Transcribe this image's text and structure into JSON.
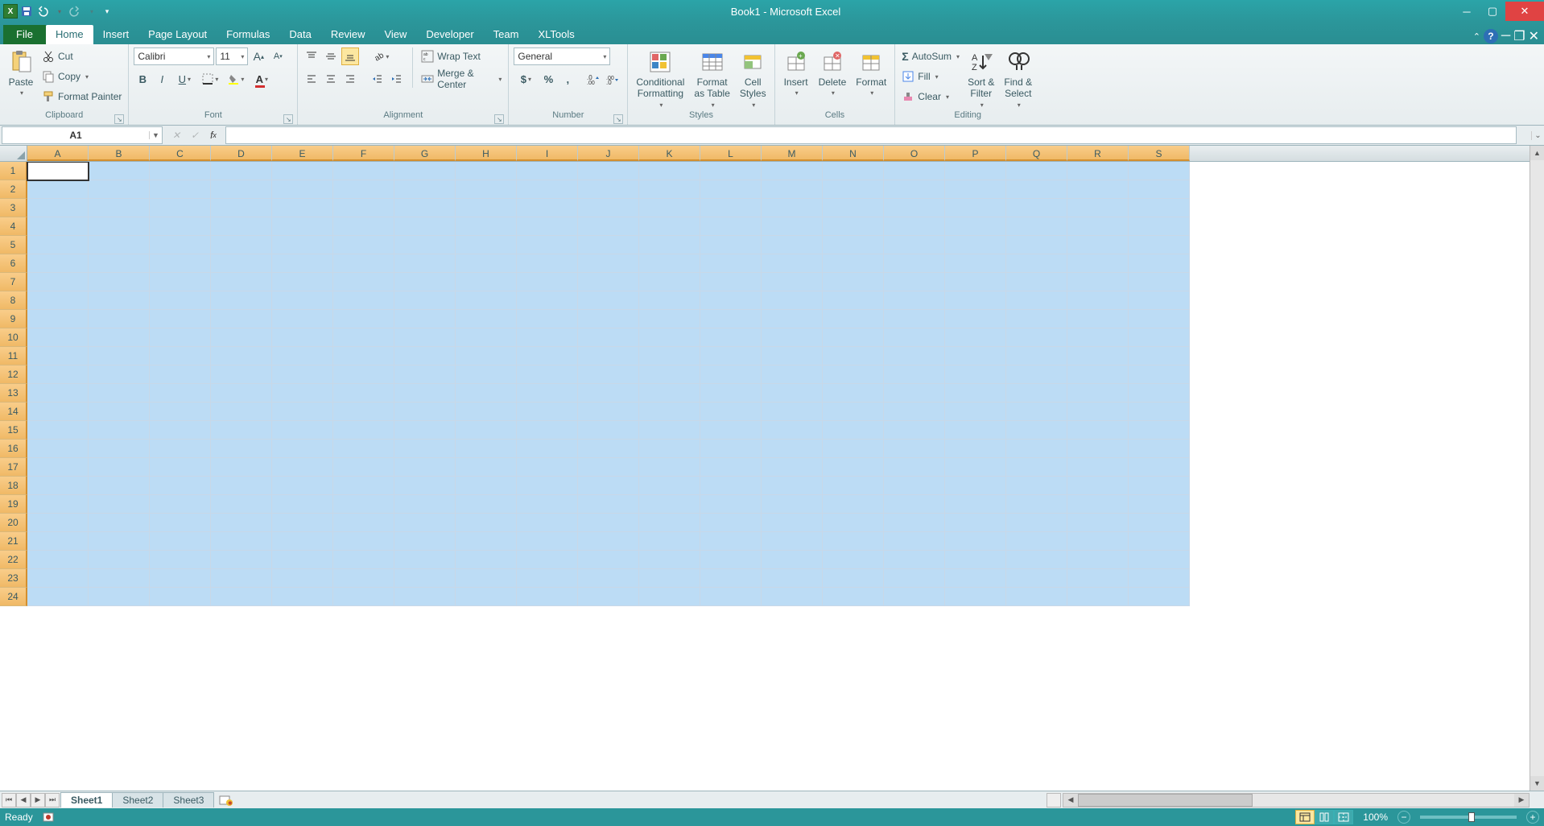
{
  "title": "Book1 - Microsoft Excel",
  "qat": {
    "save": "save",
    "undo": "undo",
    "redo": "redo"
  },
  "tabs": {
    "file": "File",
    "items": [
      "Home",
      "Insert",
      "Page Layout",
      "Formulas",
      "Data",
      "Review",
      "View",
      "Developer",
      "Team",
      "XLTools"
    ],
    "active": "Home"
  },
  "ribbon": {
    "clipboard": {
      "label": "Clipboard",
      "paste": "Paste",
      "cut": "Cut",
      "copy": "Copy",
      "format_painter": "Format Painter"
    },
    "font": {
      "label": "Font",
      "name": "Calibri",
      "size": "11"
    },
    "alignment": {
      "label": "Alignment",
      "wrap": "Wrap Text",
      "merge": "Merge & Center"
    },
    "number": {
      "label": "Number",
      "format": "General"
    },
    "styles": {
      "label": "Styles",
      "conditional": "Conditional\nFormatting",
      "table": "Format\nas Table",
      "cell": "Cell\nStyles"
    },
    "cells": {
      "label": "Cells",
      "insert": "Insert",
      "delete": "Delete",
      "format": "Format"
    },
    "editing": {
      "label": "Editing",
      "autosum": "AutoSum",
      "fill": "Fill",
      "clear": "Clear",
      "sort": "Sort &\nFilter",
      "find": "Find &\nSelect"
    }
  },
  "namebox": "A1",
  "columns": [
    "A",
    "B",
    "C",
    "D",
    "E",
    "F",
    "G",
    "H",
    "I",
    "J",
    "K",
    "L",
    "M",
    "N",
    "O",
    "P",
    "Q",
    "R",
    "S"
  ],
  "rows": [
    1,
    2,
    3,
    4,
    5,
    6,
    7,
    8,
    9,
    10,
    11,
    12,
    13,
    14,
    15,
    16,
    17,
    18,
    19,
    20,
    21,
    22,
    23,
    24
  ],
  "active_cell": "A1",
  "sheets": {
    "items": [
      "Sheet1",
      "Sheet2",
      "Sheet3"
    ],
    "active": "Sheet1"
  },
  "status": {
    "ready": "Ready",
    "zoom": "100%"
  }
}
